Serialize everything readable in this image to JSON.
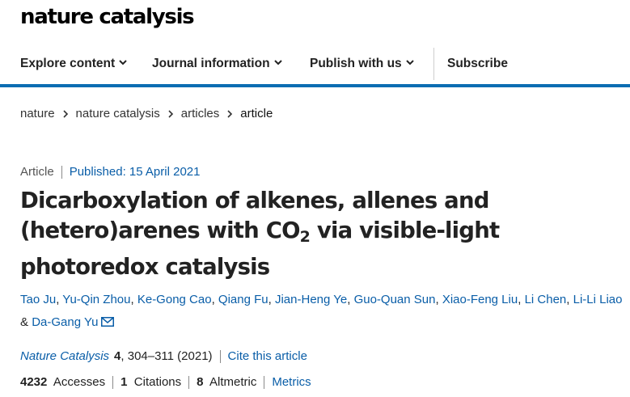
{
  "site": {
    "logo": "nature catalysis"
  },
  "nav": {
    "items": [
      {
        "label": "Explore content"
      },
      {
        "label": "Journal information"
      },
      {
        "label": "Publish with us"
      }
    ],
    "subscribe": "Subscribe",
    "accent_color": "#0b6db2"
  },
  "breadcrumb": {
    "items": [
      "nature",
      "nature catalysis",
      "articles"
    ],
    "current": "article"
  },
  "article": {
    "type": "Article",
    "published": "Published: 15 April 2021",
    "title_part1": "Dicarboxylation of alkenes, allenes and (hetero)arenes with CO",
    "title_sub": "2",
    "title_part2": " via visible-light photoredox catalysis",
    "authors": [
      "Tao Ju",
      "Yu-Qin Zhou",
      "Ke-Gong Cao",
      "Qiang Fu",
      "Jian-Heng Ye",
      "Guo-Quan Sun",
      "Xiao-Feng Liu",
      "Li Chen",
      "Li-Li Liao"
    ],
    "author_joiner": "&",
    "last_author": "Da-Gang Yu",
    "corresponding_icon": "envelope-icon",
    "journal": "Nature Catalysis",
    "volume": "4",
    "pages_year": ", 304–311 (2021)",
    "cite_label": "Cite this article",
    "link_color": "#0a5ea8"
  },
  "metrics": {
    "accesses_count": "4232",
    "accesses_label": "Accesses",
    "citations_count": "1",
    "citations_label": "Citations",
    "altmetric_count": "8",
    "altmetric_label": "Altmetric",
    "metrics_link": "Metrics"
  }
}
